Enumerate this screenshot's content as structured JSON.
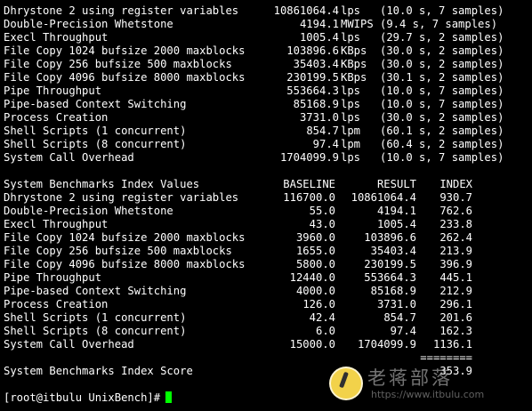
{
  "results": [
    {
      "name": "Dhrystone 2 using register variables",
      "value": "10861064.4",
      "unit": "lps",
      "detail": "(10.0 s, 7 samples)"
    },
    {
      "name": "Double-Precision Whetstone",
      "value": "4194.1",
      "unit": "MWIPS",
      "detail": "(9.4 s, 7 samples)"
    },
    {
      "name": "Execl Throughput",
      "value": "1005.4",
      "unit": "lps",
      "detail": "(29.7 s, 2 samples)"
    },
    {
      "name": "File Copy 1024 bufsize 2000 maxblocks",
      "value": "103896.6",
      "unit": "KBps",
      "detail": "(30.0 s, 2 samples)"
    },
    {
      "name": "File Copy 256 bufsize 500 maxblocks",
      "value": "35403.4",
      "unit": "KBps",
      "detail": "(30.0 s, 2 samples)"
    },
    {
      "name": "File Copy 4096 bufsize 8000 maxblocks",
      "value": "230199.5",
      "unit": "KBps",
      "detail": "(30.1 s, 2 samples)"
    },
    {
      "name": "Pipe Throughput",
      "value": "553664.3",
      "unit": "lps",
      "detail": "(10.0 s, 7 samples)"
    },
    {
      "name": "Pipe-based Context Switching",
      "value": "85168.9",
      "unit": "lps",
      "detail": "(10.0 s, 7 samples)"
    },
    {
      "name": "Process Creation",
      "value": "3731.0",
      "unit": "lps",
      "detail": "(30.0 s, 2 samples)"
    },
    {
      "name": "Shell Scripts (1 concurrent)",
      "value": "854.7",
      "unit": "lpm",
      "detail": "(60.1 s, 2 samples)"
    },
    {
      "name": "Shell Scripts (8 concurrent)",
      "value": "97.4",
      "unit": "lpm",
      "detail": "(60.4 s, 2 samples)"
    },
    {
      "name": "System Call Overhead",
      "value": "1704099.9",
      "unit": "lps",
      "detail": "(10.0 s, 7 samples)"
    }
  ],
  "index_table": {
    "header": {
      "title": "System Benchmarks Index Values",
      "baseline": "BASELINE",
      "result": "RESULT",
      "index": "INDEX"
    },
    "rows": [
      {
        "name": "Dhrystone 2 using register variables",
        "baseline": "116700.0",
        "result": "10861064.4",
        "index": "930.7"
      },
      {
        "name": "Double-Precision Whetstone",
        "baseline": "55.0",
        "result": "4194.1",
        "index": "762.6"
      },
      {
        "name": "Execl Throughput",
        "baseline": "43.0",
        "result": "1005.4",
        "index": "233.8"
      },
      {
        "name": "File Copy 1024 bufsize 2000 maxblocks",
        "baseline": "3960.0",
        "result": "103896.6",
        "index": "262.4"
      },
      {
        "name": "File Copy 256 bufsize 500 maxblocks",
        "baseline": "1655.0",
        "result": "35403.4",
        "index": "213.9"
      },
      {
        "name": "File Copy 4096 bufsize 8000 maxblocks",
        "baseline": "5800.0",
        "result": "230199.5",
        "index": "396.9"
      },
      {
        "name": "Pipe Throughput",
        "baseline": "12440.0",
        "result": "553664.3",
        "index": "445.1"
      },
      {
        "name": "Pipe-based Context Switching",
        "baseline": "4000.0",
        "result": "85168.9",
        "index": "212.9"
      },
      {
        "name": "Process Creation",
        "baseline": "126.0",
        "result": "3731.0",
        "index": "296.1"
      },
      {
        "name": "Shell Scripts (1 concurrent)",
        "baseline": "42.4",
        "result": "854.7",
        "index": "201.6"
      },
      {
        "name": "Shell Scripts (8 concurrent)",
        "baseline": "6.0",
        "result": "97.4",
        "index": "162.3"
      },
      {
        "name": "System Call Overhead",
        "baseline": "15000.0",
        "result": "1704099.9",
        "index": "1136.1"
      }
    ],
    "separator": "========",
    "score_label": "System Benchmarks Index Score",
    "score_value": "353.9"
  },
  "prompt": {
    "text": "[root@itbulu UnixBench]#"
  },
  "watermark": {
    "title": "老蒋部落",
    "url": "https://www.itbulu.com"
  },
  "colors": {
    "background": "#000000",
    "text": "#ffffff",
    "cursor": "#00ff00"
  }
}
